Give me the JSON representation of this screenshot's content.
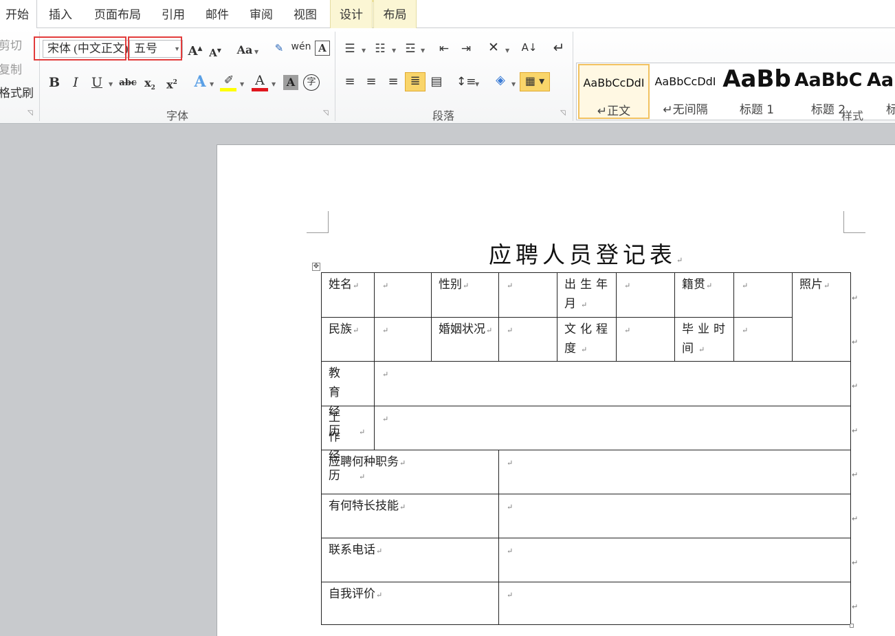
{
  "tabs": [
    {
      "label": "开始",
      "active": true
    },
    {
      "label": "插入"
    },
    {
      "label": "页面布局"
    },
    {
      "label": "引用"
    },
    {
      "label": "邮件"
    },
    {
      "label": "审阅"
    },
    {
      "label": "视图"
    },
    {
      "label": "设计",
      "contextual": true
    },
    {
      "label": "布局",
      "contextual": true
    }
  ],
  "clipboard": {
    "cut": "剪切",
    "copy": "复制",
    "format_painter": "格式刷"
  },
  "font": {
    "group_label": "字体",
    "font_name": "宋体 (中文正文)",
    "font_size": "五号",
    "highlight_color": "#ffff00",
    "font_color": "#e0161d",
    "highlight_box_color": "#e23b3b"
  },
  "paragraph": {
    "group_label": "段落"
  },
  "styles": {
    "group_label": "样式",
    "items": [
      {
        "preview": "AaBbCcDdI",
        "name": "↵正文",
        "selected": true
      },
      {
        "preview": "AaBbCcDdI",
        "name": "↵无间隔"
      },
      {
        "preview": "AaBb",
        "name": "标题 1"
      },
      {
        "preview": "AaBbC",
        "name": "标题 2"
      },
      {
        "preview": "AaB",
        "name": "标"
      }
    ]
  },
  "document": {
    "title": "应聘人员登记表",
    "paragraph_mark": "↵",
    "table": {
      "row1": [
        "姓名",
        "",
        "性别",
        "",
        "出生年月",
        "",
        "籍贯",
        "",
        "照片"
      ],
      "row2": [
        "民族",
        "",
        "婚姻状况",
        "",
        "文化程度",
        "",
        "毕业时间",
        ""
      ],
      "education_label": "教育经历",
      "work_label": "工作经历",
      "position_label": "应聘何种职务",
      "skills_label": "有何特长技能",
      "phone_label": "联系电话",
      "self_eval_label": "自我评价"
    }
  }
}
